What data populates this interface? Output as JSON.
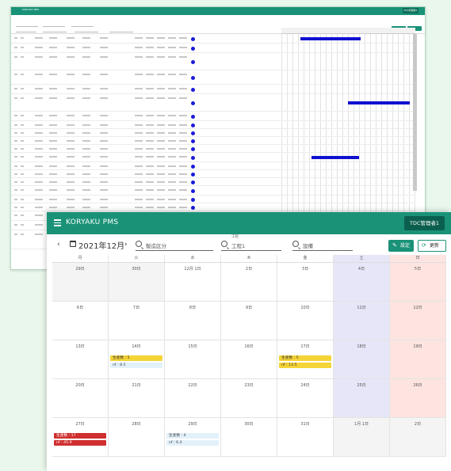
{
  "background_app": {
    "title": "KORYAKU PMS",
    "user": "TDC管理者1"
  },
  "app": {
    "title": "KORYAKU PMS",
    "user": "TDC管理者1"
  },
  "toolbar": {
    "month": "2021年12月",
    "prev": "‹",
    "next": "›",
    "filters": [
      {
        "label": "",
        "value": "製造区分"
      },
      {
        "label": "工程",
        "value": "工程1"
      },
      {
        "label": "",
        "value": "設備"
      }
    ],
    "settings_label": "設定",
    "refresh_label": "更新"
  },
  "calendar": {
    "weekdays": [
      "月",
      "火",
      "水",
      "木",
      "金",
      "土",
      "日"
    ],
    "days": [
      {
        "label": "29日",
        "type": "other"
      },
      {
        "label": "30日",
        "type": "other"
      },
      {
        "label": "12月 1日",
        "type": "weekday"
      },
      {
        "label": "2日",
        "type": "weekday"
      },
      {
        "label": "3日",
        "type": "weekday"
      },
      {
        "label": "4日",
        "type": "sat"
      },
      {
        "label": "5日",
        "type": "sun"
      },
      {
        "label": "6日",
        "type": "weekday"
      },
      {
        "label": "7日",
        "type": "weekday"
      },
      {
        "label": "8日",
        "type": "weekday"
      },
      {
        "label": "9日",
        "type": "weekday"
      },
      {
        "label": "10日",
        "type": "weekday"
      },
      {
        "label": "11日",
        "type": "sat"
      },
      {
        "label": "12日",
        "type": "sun"
      },
      {
        "label": "13日",
        "type": "weekday"
      },
      {
        "label": "14日",
        "type": "weekday",
        "events": [
          {
            "text": "生産数 : 5",
            "style": "y"
          },
          {
            "text": "nf    : 8.5",
            "style": "b"
          }
        ]
      },
      {
        "label": "15日",
        "type": "weekday"
      },
      {
        "label": "16日",
        "type": "weekday"
      },
      {
        "label": "17日",
        "type": "weekday",
        "events": [
          {
            "text": "生産数 : 5",
            "style": "y"
          },
          {
            "text": "nf    : 13.5",
            "style": "y"
          }
        ]
      },
      {
        "label": "18日",
        "type": "sat"
      },
      {
        "label": "19日",
        "type": "sun"
      },
      {
        "label": "20日",
        "type": "weekday"
      },
      {
        "label": "21日",
        "type": "weekday"
      },
      {
        "label": "22日",
        "type": "weekday"
      },
      {
        "label": "23日",
        "type": "weekday"
      },
      {
        "label": "24日",
        "type": "weekday"
      },
      {
        "label": "25日",
        "type": "sat"
      },
      {
        "label": "26日",
        "type": "sun"
      },
      {
        "label": "27日",
        "type": "weekday",
        "events": [
          {
            "text": "生産数 : 17",
            "style": "r"
          },
          {
            "text": "nf    : 45.9",
            "style": "r"
          }
        ]
      },
      {
        "label": "28日",
        "type": "weekday"
      },
      {
        "label": "29日",
        "type": "weekday",
        "events": [
          {
            "text": "生産数 : 4",
            "style": "b"
          },
          {
            "text": "nf    : 6.4",
            "style": "b"
          }
        ]
      },
      {
        "label": "30日",
        "type": "weekday"
      },
      {
        "label": "31日",
        "type": "weekday"
      },
      {
        "label": "1月 1日",
        "type": "other"
      },
      {
        "label": "2日",
        "type": "other"
      }
    ]
  },
  "colors": {
    "brand": "#1a9278",
    "event_yellow": "#f5d437",
    "event_red": "#cf2f2f",
    "event_blue": "#e3f1fb",
    "saturday": "#e6e6f8",
    "sunday": "#fde4e1"
  }
}
